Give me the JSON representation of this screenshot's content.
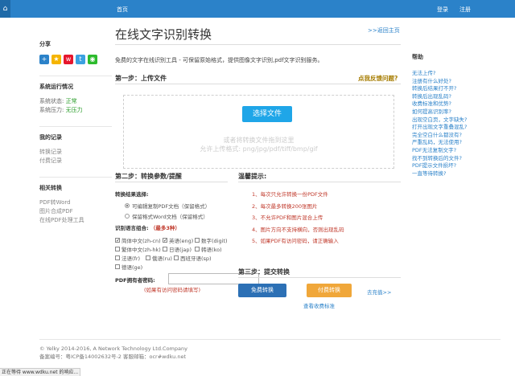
{
  "topbar": {
    "home": "首页",
    "login": "登录",
    "register": "注册",
    "menu_icon": "home-icon"
  },
  "left": {
    "share": {
      "title": "分享",
      "icons": [
        "add-share-icon",
        "star-icon",
        "weibo-icon",
        "tencent-weibo-icon",
        "wechat-icon"
      ]
    },
    "status": {
      "title": "系统运行情况",
      "state_label": "系统状态:",
      "state_value": "正常",
      "load_label": "系统压力:",
      "load_value": "无压力"
    },
    "records": {
      "title": "我的记录",
      "items": [
        "转换记录",
        "付费记录"
      ]
    },
    "related": {
      "title": "相关转换",
      "items": [
        "PDF转Word",
        "图片合成PDF",
        "在线PDF处理工具"
      ]
    }
  },
  "main": {
    "title": "在线文字识别转换",
    "back": ">>返回主页",
    "intro": "免费的文字在线识别工具 - 可保留原始格式，提供图像文字识别,pdf文字识别服务。",
    "step1": "第一步：上传文件",
    "feedback": "点我反馈问题?",
    "upload_button": "选择文件",
    "drop_hint": "或者将转换文件拖到这里",
    "formats": "允许上传格式: png/jpg/pdf/tiff/bmp/gif",
    "step2": "第二步：转换参数/提醒",
    "result_label": "转换结果选择:",
    "result_options": [
      {
        "label": "可编辑复制PDF文档（保留格式）",
        "selected": true
      },
      {
        "label": "保留格式Word文档（保留格式）",
        "selected": false
      }
    ],
    "lang_label": "识别语言组合:",
    "lang_note": "（最多3种）",
    "languages": [
      {
        "label": "简体中文(zh-cn)",
        "checked": true
      },
      {
        "label": "英语(eng)",
        "checked": true
      },
      {
        "label": "数字(digit)",
        "checked": false
      },
      {
        "label": "繁体中文(zh-hk)",
        "checked": false
      },
      {
        "label": "日语(jap)",
        "checked": false
      },
      {
        "label": "韩语(ko)",
        "checked": false
      },
      {
        "label": "法语(fr)",
        "checked": false
      },
      {
        "label": "俄语(ru)",
        "checked": false
      },
      {
        "label": "西班牙语(sp)",
        "checked": false
      },
      {
        "label": "德语(ge)",
        "checked": false
      }
    ],
    "pwd_label": "PDF拥有者密码:",
    "pwd_value": "",
    "pwd_note": "(如果有访问密码请填写)",
    "tips_title": "温馨提示:",
    "tips": [
      "1、每次只允许转换一份PDF文件",
      "2、每次最多转换200张图片",
      "3、不允许PDF和图片混合上传",
      "4、图片方向不支持横向，否则出现乱码",
      "5、如果PDF有访问密码，请正确输入"
    ],
    "step3": "第三步：提交转换",
    "free_button": "免费转换",
    "pay_button": "付费转换",
    "pricing_link": "查看收费标准",
    "unpaid_link": "去充值>>"
  },
  "help": {
    "title": "帮助",
    "items": [
      "无法上传?",
      "注册有什么好处?",
      "转换后结果打不开?",
      "转换后出现乱码?",
      "收费标准和优势?",
      "如何提高识别率?",
      "出现空白页，文字缺失?",
      "打开出现文字重叠混乱?",
      "完全空白什么都没有?",
      "严重乱码，无法使用?",
      "PDF无法复制文字?",
      "找不到转换后的文件?",
      "PDF提示文件损坏?",
      "一直等待转换?"
    ]
  },
  "footer": {
    "copyright": "© Yelky 2014-2016, A Network Technology Ltd.Company",
    "icp": "备案编号：粤ICP备14002632号-2  客服邮箱：ocr#wdku.net"
  },
  "statusbar": {
    "text": "正在等待 www.wdku.net 的响应..."
  },
  "colors": {
    "topbar": "#2b82c9",
    "upload_button": "#1fa6e8",
    "free_button": "#2c70b5",
    "pay_button": "#f0a73a",
    "alert_red": "#c0392b",
    "link_blue": "#2b82c9"
  }
}
